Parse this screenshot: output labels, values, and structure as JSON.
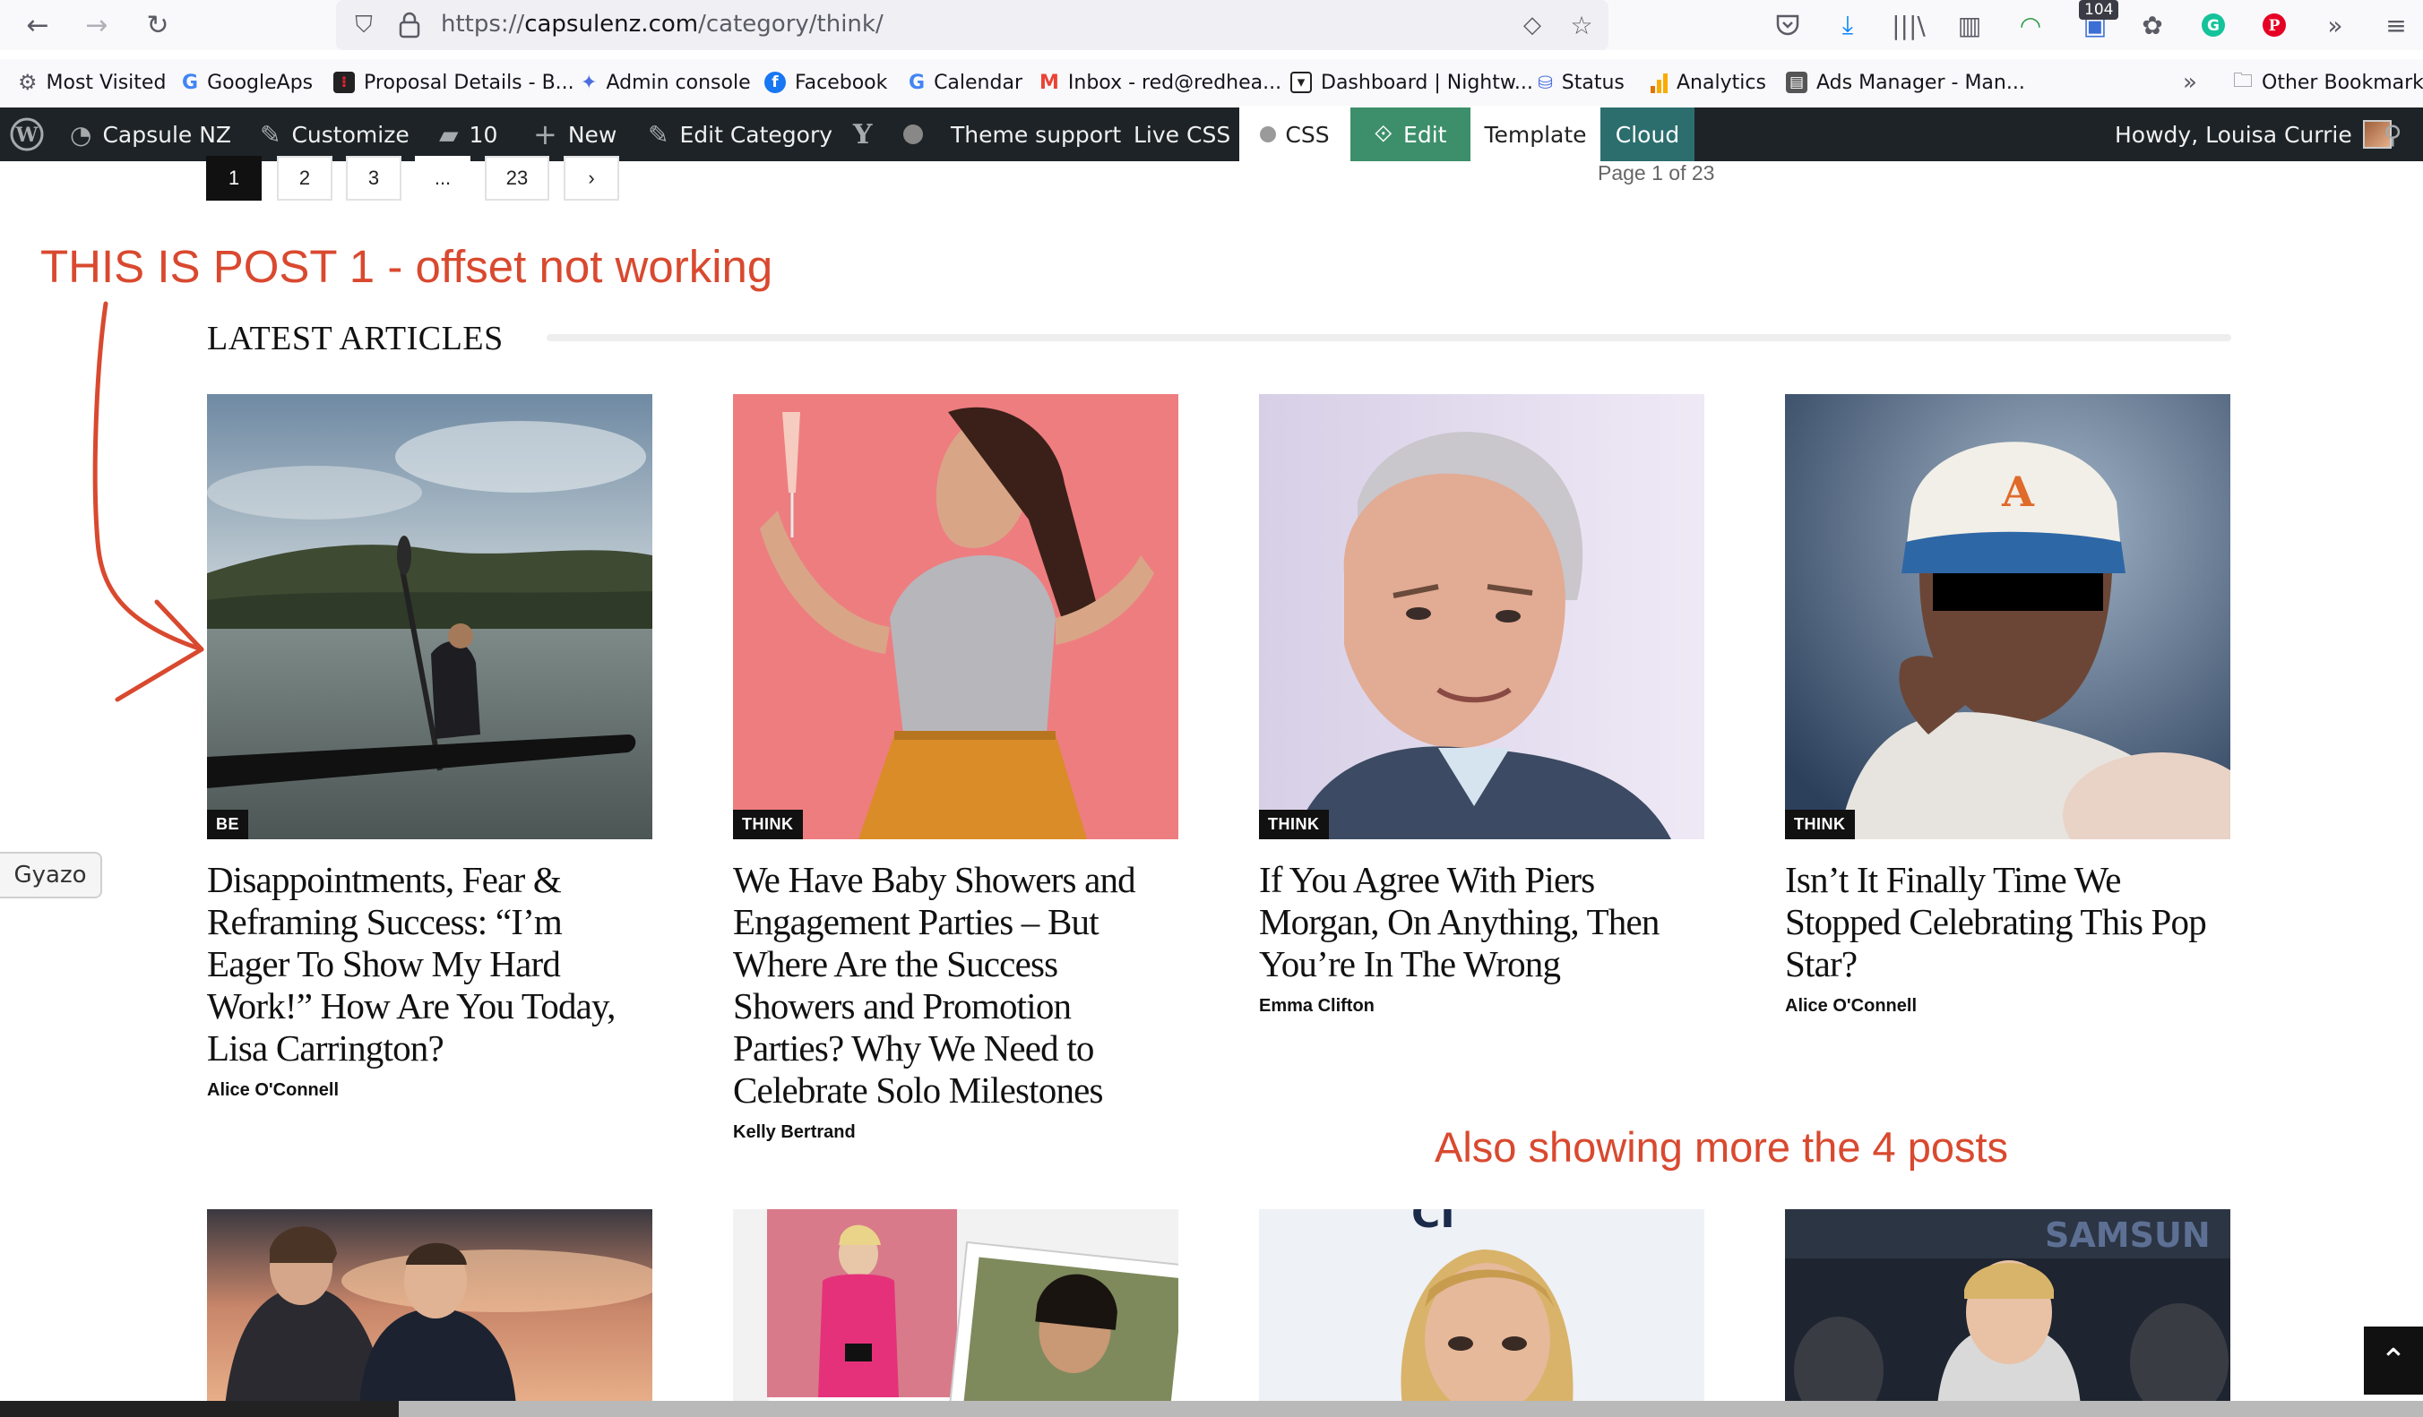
{
  "browser": {
    "url_prefix": "https://",
    "url_host": "capsulenz.com",
    "url_path": "/category/think/",
    "notification_count": "104"
  },
  "bookmarks": [
    {
      "label": "Most Visited",
      "icon": "gear-icon",
      "color": "#5b5b66"
    },
    {
      "label": "GoogleAps",
      "icon": "google-icon",
      "color": "#4285f4"
    },
    {
      "label": "Proposal Details - B...",
      "icon": "proposal-icon",
      "color": "#222222"
    },
    {
      "label": "Admin console",
      "icon": "admin-icon",
      "color": "#4a6ee0"
    },
    {
      "label": "Facebook",
      "icon": "facebook-icon",
      "color": "#1877f2"
    },
    {
      "label": "Calendar",
      "icon": "google-icon",
      "color": "#4285f4"
    },
    {
      "label": "Inbox - red@redhea...",
      "icon": "gmail-icon",
      "color": "#ea4335"
    },
    {
      "label": "Dashboard | Nightw...",
      "icon": "dashboard-icon",
      "color": "#222222"
    },
    {
      "label": "Status",
      "icon": "status-icon",
      "color": "#4a6ee0"
    },
    {
      "label": "Analytics",
      "icon": "analytics-icon",
      "color": "#f9ab00"
    },
    {
      "label": "Ads Manager - Man...",
      "icon": "ads-icon",
      "color": "#555555"
    },
    {
      "label": "Other Bookmarks",
      "icon": "folder-icon",
      "color": "#5b5b66"
    }
  ],
  "adminbar": {
    "site_name": "Capsule NZ",
    "customize": "Customize",
    "comments_count": "10",
    "new": "New",
    "edit_category": "Edit Category",
    "theme_support": "Theme support",
    "live_css": "Live CSS",
    "css": "CSS",
    "edit": "Edit",
    "template": "Template",
    "cloud": "Cloud",
    "howdy": "Howdy, Louisa Currie"
  },
  "pagination": {
    "pages": [
      "1",
      "2",
      "3",
      "...",
      "23"
    ],
    "next": "›",
    "info": "Page 1 of 23"
  },
  "annotations": {
    "post1": "THIS IS POST 1 - offset not working",
    "more_posts": "Also showing more the 4 posts"
  },
  "section_title": "LATEST ARTICLES",
  "articles": [
    {
      "category": "BE",
      "title": "Disappointments, Fear & Reframing Success: “I’m Eager To Show My Hard Work!” How Are You Today, Lisa Carrington?",
      "author": "Alice O'Connell"
    },
    {
      "category": "THINK",
      "title": "We Have Baby Showers and Engagement Parties – But Where Are the Success Showers and Promotion Parties? Why We Need to Celebrate Solo Milestones",
      "author": "Kelly Bertrand"
    },
    {
      "category": "THINK",
      "title": "If You Agree With Piers Morgan, On Anything, Then You’re In The Wrong",
      "author": "Emma Clifton"
    },
    {
      "category": "THINK",
      "title": "Isn’t It Finally Time We Stopped Celebrating This Pop Star?",
      "author": "Alice O'Connell"
    }
  ],
  "gyazo": "Gyazo",
  "colors": {
    "annotation": "#d9492f",
    "adminbar": "#1d2327",
    "edit_green": "#3c8f6a",
    "cloud_teal": "#2c6e6e"
  }
}
